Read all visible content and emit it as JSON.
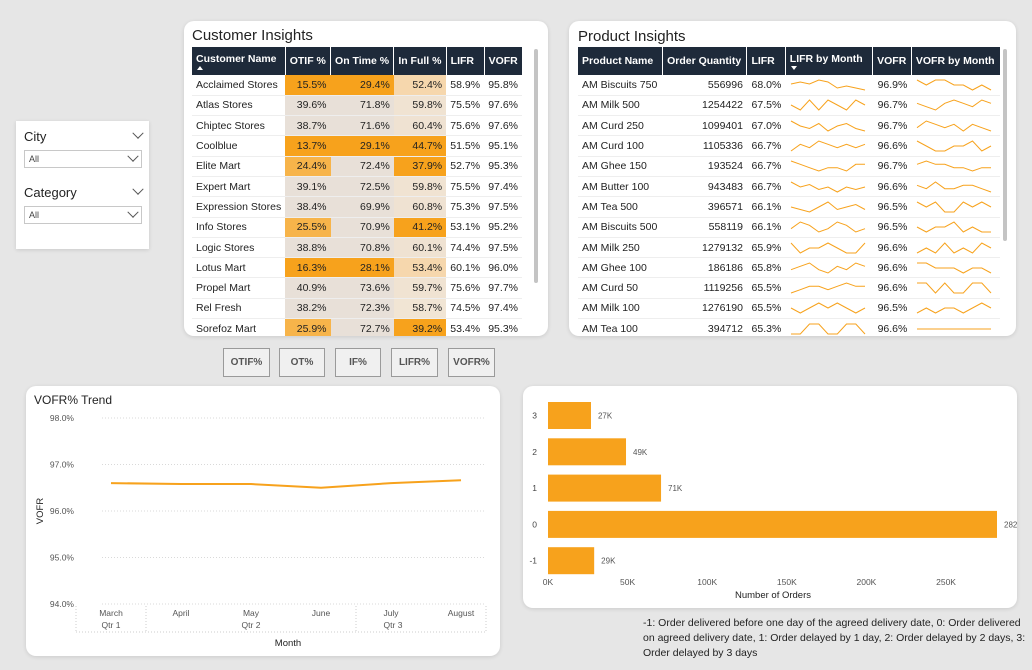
{
  "slicers": [
    {
      "label": "City",
      "value": "All"
    },
    {
      "label": "Category",
      "value": "All"
    }
  ],
  "customer_insights": {
    "title": "Customer Insights",
    "columns": [
      "Customer Name",
      "OTIF %",
      "On Time %",
      "In Full %",
      "LIFR",
      "VOFR"
    ],
    "rows": [
      [
        "Acclaimed Stores",
        "15.5%",
        "29.4%",
        "52.4%",
        "58.9%",
        "95.8%"
      ],
      [
        "Atlas Stores",
        "39.6%",
        "71.8%",
        "59.8%",
        "75.5%",
        "97.6%"
      ],
      [
        "Chiptec Stores",
        "38.7%",
        "71.6%",
        "60.4%",
        "75.6%",
        "97.6%"
      ],
      [
        "Coolblue",
        "13.7%",
        "29.1%",
        "44.7%",
        "51.5%",
        "95.1%"
      ],
      [
        "Elite Mart",
        "24.4%",
        "72.4%",
        "37.9%",
        "52.7%",
        "95.3%"
      ],
      [
        "Expert Mart",
        "39.1%",
        "72.5%",
        "59.8%",
        "75.5%",
        "97.4%"
      ],
      [
        "Expression Stores",
        "38.4%",
        "69.9%",
        "60.8%",
        "75.3%",
        "97.5%"
      ],
      [
        "Info Stores",
        "25.5%",
        "70.9%",
        "41.2%",
        "53.1%",
        "95.2%"
      ],
      [
        "Logic Stores",
        "38.8%",
        "70.8%",
        "60.1%",
        "74.4%",
        "97.5%"
      ],
      [
        "Lotus Mart",
        "16.3%",
        "28.1%",
        "53.4%",
        "60.1%",
        "96.0%"
      ],
      [
        "Propel Mart",
        "40.9%",
        "73.6%",
        "59.7%",
        "75.6%",
        "97.7%"
      ],
      [
        "Rel Fresh",
        "38.2%",
        "72.3%",
        "58.7%",
        "74.5%",
        "97.4%"
      ],
      [
        "Sorefoz Mart",
        "25.9%",
        "72.7%",
        "39.2%",
        "53.4%",
        "95.3%"
      ]
    ],
    "cell_colors": [
      [
        "#f7a21c",
        "#f7a21c",
        "#f6d7ad"
      ],
      [
        "#e8e0d8",
        "#e8e0d8",
        "#f0e3d2"
      ],
      [
        "#e8e0d8",
        "#e8e0d8",
        "#efe2d2"
      ],
      [
        "#f7a21c",
        "#f7a21c",
        "#f7a21c"
      ],
      [
        "#f7b44a",
        "#e8e0d8",
        "#f7a21c"
      ],
      [
        "#e8e0d8",
        "#e8e0d8",
        "#f0e3d2"
      ],
      [
        "#e8e0d8",
        "#e8e0d8",
        "#efe2d2"
      ],
      [
        "#f7b44a",
        "#e8e0d8",
        "#f7a21c"
      ],
      [
        "#e8e0d8",
        "#e8e0d8",
        "#efe2d2"
      ],
      [
        "#f7a21c",
        "#f7a21c",
        "#f6d7ad"
      ],
      [
        "#e8e0d8",
        "#e8e0d8",
        "#f0e3d2"
      ],
      [
        "#e8e0d8",
        "#e8e0d8",
        "#f1e5d4"
      ],
      [
        "#f7b44a",
        "#e8e0d8",
        "#f7a21c"
      ]
    ]
  },
  "product_insights": {
    "title": "Product Insights",
    "columns": [
      "Product Name",
      "Order Quantity",
      "LIFR",
      "LIFR by Month",
      "VOFR",
      "VOFR by Month"
    ],
    "rows": [
      [
        "AM Biscuits 750",
        "556996",
        "68.0%",
        "96.9%"
      ],
      [
        "AM Milk 500",
        "1254422",
        "67.5%",
        "96.7%"
      ],
      [
        "AM Curd 250",
        "1099401",
        "67.0%",
        "96.7%"
      ],
      [
        "AM Curd 100",
        "1105336",
        "66.7%",
        "96.6%"
      ],
      [
        "AM Ghee 150",
        "193524",
        "66.7%",
        "96.7%"
      ],
      [
        "AM Butter 100",
        "943483",
        "66.7%",
        "96.6%"
      ],
      [
        "AM Tea 500",
        "396571",
        "66.1%",
        "96.5%"
      ],
      [
        "AM Biscuits 500",
        "558119",
        "66.1%",
        "96.5%"
      ],
      [
        "AM Milk 250",
        "1279132",
        "65.9%",
        "96.6%"
      ],
      [
        "AM Ghee 100",
        "186186",
        "65.8%",
        "96.6%"
      ],
      [
        "AM Curd 50",
        "1119256",
        "65.5%",
        "96.6%"
      ],
      [
        "AM Milk 100",
        "1276190",
        "65.5%",
        "96.5%"
      ],
      [
        "AM Tea 100",
        "394712",
        "65.3%",
        "96.6%"
      ]
    ],
    "spark_lifr": [
      [
        4,
        5,
        4,
        6,
        5,
        2,
        3,
        2,
        1
      ],
      [
        3,
        2,
        4,
        2,
        4,
        3,
        2,
        4,
        3
      ],
      [
        5,
        3,
        2,
        4,
        1,
        3,
        4,
        2,
        1
      ],
      [
        1,
        3,
        2,
        4,
        3,
        2,
        3,
        2,
        3
      ],
      [
        4,
        3,
        2,
        1,
        2,
        2,
        1,
        3,
        3
      ],
      [
        5,
        3,
        4,
        2,
        3,
        1,
        3,
        2,
        3
      ],
      [
        3,
        2,
        1,
        3,
        5,
        2,
        3,
        4,
        2
      ],
      [
        2,
        4,
        3,
        1,
        2,
        4,
        3,
        1,
        2
      ],
      [
        3,
        1,
        2,
        2,
        3,
        2,
        1,
        1,
        3
      ],
      [
        2,
        3,
        4,
        2,
        1,
        3,
        2,
        4,
        3
      ],
      [
        1,
        2,
        3,
        3,
        2,
        3,
        4,
        3,
        3
      ],
      [
        2,
        1,
        2,
        3,
        2,
        3,
        2,
        1,
        2
      ],
      [
        2,
        2,
        3,
        3,
        2,
        2,
        3,
        3,
        2
      ]
    ],
    "spark_vofr": [
      [
        3,
        2,
        3,
        3,
        2,
        2,
        1,
        2,
        1
      ],
      [
        3,
        2,
        1,
        3,
        4,
        3,
        2,
        4,
        3
      ],
      [
        2,
        4,
        3,
        2,
        3,
        1,
        3,
        2,
        1
      ],
      [
        4,
        3,
        2,
        2,
        3,
        3,
        4,
        2,
        3
      ],
      [
        3,
        4,
        3,
        3,
        2,
        2,
        1,
        2,
        2
      ],
      [
        3,
        2,
        4,
        2,
        2,
        3,
        3,
        2,
        1
      ],
      [
        3,
        2,
        3,
        1,
        1,
        3,
        2,
        3,
        2
      ],
      [
        3,
        2,
        3,
        3,
        4,
        2,
        3,
        2,
        2
      ],
      [
        2,
        3,
        2,
        4,
        2,
        3,
        2,
        4,
        3
      ],
      [
        3,
        3,
        2,
        2,
        2,
        1,
        2,
        2,
        1
      ],
      [
        3,
        3,
        2,
        3,
        2,
        2,
        3,
        3,
        2
      ],
      [
        2,
        3,
        2,
        3,
        3,
        2,
        3,
        4,
        3
      ],
      [
        3,
        3,
        3,
        3,
        3,
        3,
        3,
        3,
        3
      ]
    ]
  },
  "buttons": [
    "OTIF%",
    "OT%",
    "IF%",
    "LIFR%",
    "VOFR%"
  ],
  "vofr_trend": {
    "title": "VOFR% Trend",
    "ylabel": "VOFR",
    "xlabel": "Month",
    "y_ticks": [
      "98.0%",
      "97.0%",
      "96.0%",
      "95.0%",
      "94.0%"
    ],
    "months": [
      "March",
      "April",
      "May",
      "June",
      "July",
      "August"
    ],
    "quarters": [
      "Qtr 1",
      "Qtr 2",
      "Qtr 3"
    ]
  },
  "delay_chart": {
    "xlabel": "Number of Orders",
    "x_ticks": [
      "0K",
      "50K",
      "100K",
      "150K",
      "200K",
      "250K"
    ],
    "bar_labels": [
      "27K",
      "49K",
      "71K",
      "282K",
      "29K"
    ],
    "categories": [
      "3",
      "2",
      "1",
      "0",
      "-1"
    ]
  },
  "chart_data": [
    {
      "type": "line",
      "title": "VOFR% Trend",
      "xlabel": "Month",
      "ylabel": "VOFR",
      "x": [
        "March",
        "April",
        "May",
        "June",
        "July",
        "August"
      ],
      "values": [
        96.6,
        96.58,
        96.58,
        96.5,
        96.6,
        96.66
      ],
      "ylim": [
        94.0,
        98.0
      ],
      "color": "#f7a21c"
    },
    {
      "type": "bar",
      "orientation": "horizontal",
      "xlabel": "Number of Orders",
      "categories": [
        "3",
        "2",
        "1",
        "0",
        "-1"
      ],
      "values": [
        27,
        49,
        71,
        282,
        29
      ],
      "xlim": [
        0,
        290
      ],
      "color": "#f7a21c"
    }
  ],
  "legend_note": "-1: Order delivered before one day of the agreed delivery date, 0: Order delivered on agreed delivery date, 1: Order delayed by 1 day, 2: Order delayed by 2 days, 3: Order delayed by 3 days"
}
